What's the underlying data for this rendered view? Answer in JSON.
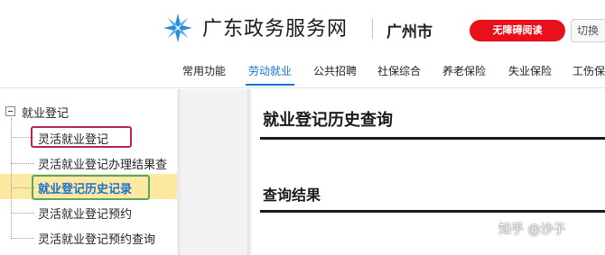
{
  "header": {
    "site_title": "广东政务服务网",
    "city": "广州市",
    "accessibility_label": "无障碍阅读",
    "switch_label": "切换",
    "logo_icon": "starburst-logo-icon",
    "accent_color": "#1677d2",
    "alert_color": "#e8101a"
  },
  "topnav": {
    "items": [
      {
        "label": "常用功能"
      },
      {
        "label": "劳动就业",
        "active": true
      },
      {
        "label": "公共招聘"
      },
      {
        "label": "社保综合"
      },
      {
        "label": "养老保险"
      },
      {
        "label": "失业保险"
      },
      {
        "label": "工伤保"
      }
    ]
  },
  "sidebar": {
    "root_label": "就业登记",
    "toggle_icon": "tree-collapse-icon",
    "items": [
      {
        "label": "灵活就业登记"
      },
      {
        "label": "灵活就业登记办理结果查"
      },
      {
        "label": "就业登记历史记录",
        "selected": true
      },
      {
        "label": "灵活就业登记预约"
      },
      {
        "label": "灵活就业登记预约查询"
      }
    ],
    "selected_bg": "#fde9a0"
  },
  "main": {
    "page_title": "就业登记历史查询",
    "results_heading": "查询结果"
  },
  "watermark": "知乎 @沙子"
}
